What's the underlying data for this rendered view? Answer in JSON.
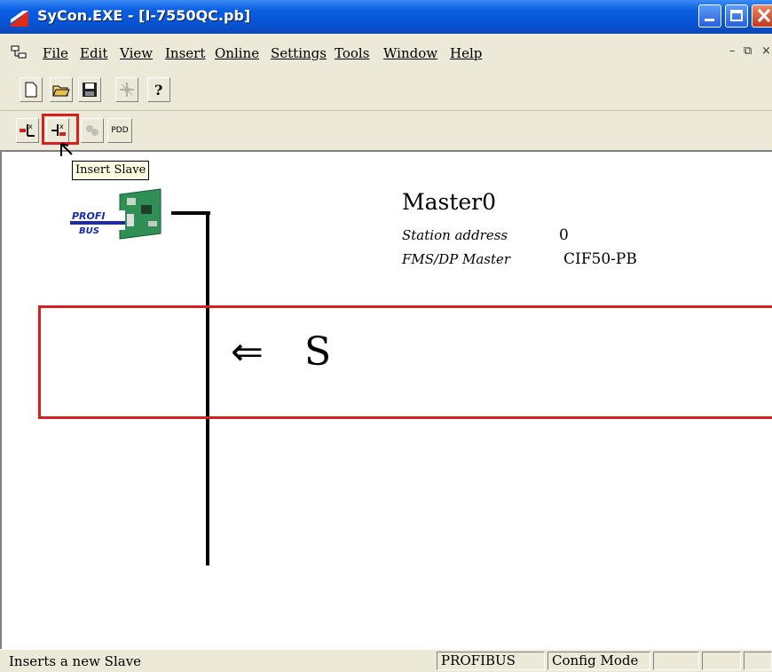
{
  "window": {
    "title": "SyCon.EXE - [I-7550QC.pb]"
  },
  "menu": {
    "items": [
      {
        "label": "File"
      },
      {
        "label": "Edit"
      },
      {
        "label": "View"
      },
      {
        "label": "Insert"
      },
      {
        "label": "Online"
      },
      {
        "label": "Settings"
      },
      {
        "label": "Tools"
      },
      {
        "label": "Window"
      },
      {
        "label": "Help"
      }
    ]
  },
  "toolbar2": {
    "pdd_label": "PDD"
  },
  "tooltip": {
    "text": "Insert Slave"
  },
  "master": {
    "name": "Master0",
    "station_label": "Station address",
    "station_value": "0",
    "type_label": "FMS/DP Master",
    "type_value": "CIF50-PB"
  },
  "annotation": {
    "arrow": "⇐",
    "letter": "S"
  },
  "colors": {
    "highlight": "#d42020",
    "titlebar": "#0754d4"
  },
  "status": {
    "text": "Inserts a new Slave",
    "protocol": "PROFIBUS",
    "mode": "Config Mode"
  }
}
